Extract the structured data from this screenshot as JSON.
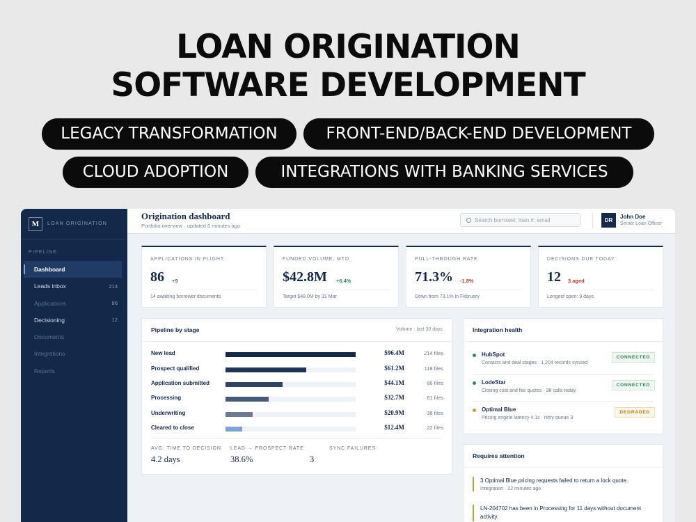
{
  "hero": {
    "title_line1": "LOAN ORIGINATION",
    "title_line2": "SOFTWARE DEVELOPMENT",
    "pills": [
      "LEGACY TRANSFORMATION",
      "FRONT-END/BACK-END DEVELOPMENT",
      "CLOUD ADOPTION",
      "INTEGRATIONS WITH BANKING SERVICES"
    ]
  },
  "sidebar": {
    "logo_mark": "M",
    "logo_text": "LOAN ORIGINATION",
    "section_label": "PIPELINE",
    "items": [
      {
        "label": "Dashboard",
        "count": ""
      },
      {
        "label": "Leads inbox",
        "count": "214"
      },
      {
        "label": "Applications",
        "count": "86"
      },
      {
        "label": "Decisioning",
        "count": "12"
      },
      {
        "label": "Documents",
        "count": ""
      },
      {
        "label": "Integrations",
        "count": ""
      },
      {
        "label": "Reports",
        "count": ""
      }
    ]
  },
  "header": {
    "title": "Origination dashboard",
    "subtitle": "Portfolio overview · updated 6 minutes ago",
    "search_placeholder": "Search borrower, loan #, email",
    "user_initials": "DR",
    "user_name": "John Doe",
    "user_role": "Senior Loan Officer"
  },
  "kpis": [
    {
      "label": "APPLICATIONS IN FLIGHT",
      "value": "86",
      "delta": "+9",
      "tone": "pos",
      "foot": "14 awaiting borrower documents"
    },
    {
      "label": "FUNDED VOLUME, MTD",
      "value": "$42.8M",
      "delta": "+6.4%",
      "tone": "pos",
      "foot": "Target $48.0M by 31 Mar"
    },
    {
      "label": "PULL-THROUGH RATE",
      "value": "71.3%",
      "delta": "-1.8%",
      "tone": "neg",
      "foot": "Down from 73.1% in February"
    },
    {
      "label": "DECISIONS DUE TODAY",
      "value": "12",
      "delta": "3 aged",
      "tone": "neg",
      "foot": "Longest open: 9 days"
    }
  ],
  "pipeline": {
    "title": "Pipeline by stage",
    "meta": "Volume · last 30 days",
    "stages": [
      {
        "name": "New lead",
        "amount": "$96.4M",
        "files": "214 files",
        "fill": 1.0,
        "color": "#14284a"
      },
      {
        "name": "Prospect qualified",
        "amount": "$61.2M",
        "files": "118 files",
        "fill": 0.62,
        "color": "#1e3556"
      },
      {
        "name": "Application submitted",
        "amount": "$44.1M",
        "files": "86 files",
        "fill": 0.44,
        "color": "#2f4566"
      },
      {
        "name": "Processing",
        "amount": "$32.7M",
        "files": "61 files",
        "fill": 0.33,
        "color": "#485b78"
      },
      {
        "name": "Underwriting",
        "amount": "$20.9M",
        "files": "38 files",
        "fill": 0.21,
        "color": "#6e7b92"
      },
      {
        "name": "Cleared to close",
        "amount": "$12.4M",
        "files": "22 files",
        "fill": 0.13,
        "color": "#7ea3d6"
      }
    ],
    "stats": [
      {
        "label": "AVG. TIME TO DECISION",
        "value": "4.2 days",
        "tone": ""
      },
      {
        "label": "LEAD → PROSPECT RATE",
        "value": "38.6%",
        "tone": ""
      },
      {
        "label": "SYNC FAILURES",
        "value": "3",
        "tone": "neg"
      }
    ]
  },
  "integrations": {
    "title": "Integration health",
    "items": [
      {
        "name": "HubSpot",
        "desc": "Contacts and deal stages · 1,204 records synced",
        "status": "CONNECTED",
        "dot": "#2e8b57",
        "badge_bg": "#eef7f1",
        "badge_fg": "#2e7d4f",
        "badge_border": "#cfe6d8"
      },
      {
        "name": "LodeStar",
        "desc": "Closing cost and fee quotes · 38 calls today",
        "status": "CONNECTED",
        "dot": "#2e8b57",
        "badge_bg": "#eef7f1",
        "badge_fg": "#2e7d4f",
        "badge_border": "#cfe6d8"
      },
      {
        "name": "Optimal Blue",
        "desc": "Pricing engine latency 4.1s · retry queue 3",
        "status": "DEGRADED",
        "dot": "#c99a3b",
        "badge_bg": "#fdf5e6",
        "badge_fg": "#b07a1c",
        "badge_border": "#f0dcb2"
      }
    ]
  },
  "attention": {
    "title": "Requires attention",
    "items": [
      {
        "text": "3 Optimal Blue pricing requests failed to return a lock quote.",
        "meta": "Integration · 22 minutes ago"
      },
      {
        "text": "LN-204702 has been in Processing for 11 days without document activity.",
        "meta": ""
      }
    ]
  }
}
